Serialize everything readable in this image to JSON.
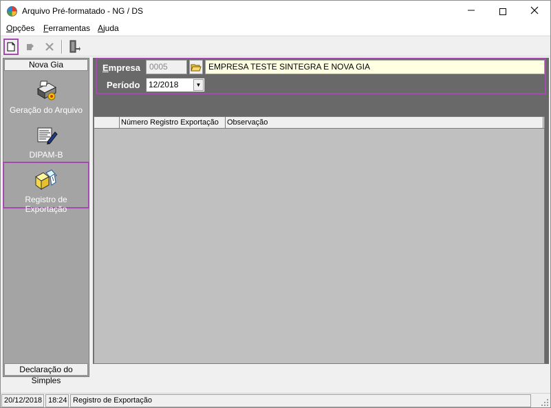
{
  "window": {
    "title": "Arquivo Pré-formatado - NG / DS"
  },
  "menu": {
    "items": [
      {
        "accel": "O",
        "rest": "pções"
      },
      {
        "accel": "F",
        "rest": "erramentas"
      },
      {
        "accel": "A",
        "rest": "juda"
      }
    ]
  },
  "toolbar": {
    "icons": [
      "new-document-icon",
      "edit-icon",
      "delete-icon",
      "exit-door-icon"
    ]
  },
  "left_panel": {
    "header": "Nova Gia",
    "footer": "Declaração do Simples",
    "items": [
      {
        "label": "Geração do Arquivo",
        "icon": "printer-gear-icon"
      },
      {
        "label": "DIPAM-B",
        "icon": "report-pen-icon"
      },
      {
        "label": "Registro de Exportação",
        "icon": "export-register-icon"
      }
    ]
  },
  "form": {
    "empresa_label_accel": "E",
    "empresa_label_rest": "mpresa",
    "empresa_code": "0005",
    "empresa_name": "EMPRESA TESTE SINTEGRA E NOVA GIA",
    "periodo_label": "Período",
    "periodo_value": "12/2018"
  },
  "grid": {
    "columns": [
      "",
      "Número Registro Exportação",
      "Observação"
    ]
  },
  "statusbar": {
    "date": "20/12/2018",
    "time": "18:24",
    "message": "Registro de Exportação"
  },
  "colors": {
    "highlight": "#a54bb0",
    "panel": "#a4a4a4",
    "main_bg": "#696969",
    "grid_bg": "#c0c0c0",
    "name_field_bg": "#ffffe1"
  }
}
